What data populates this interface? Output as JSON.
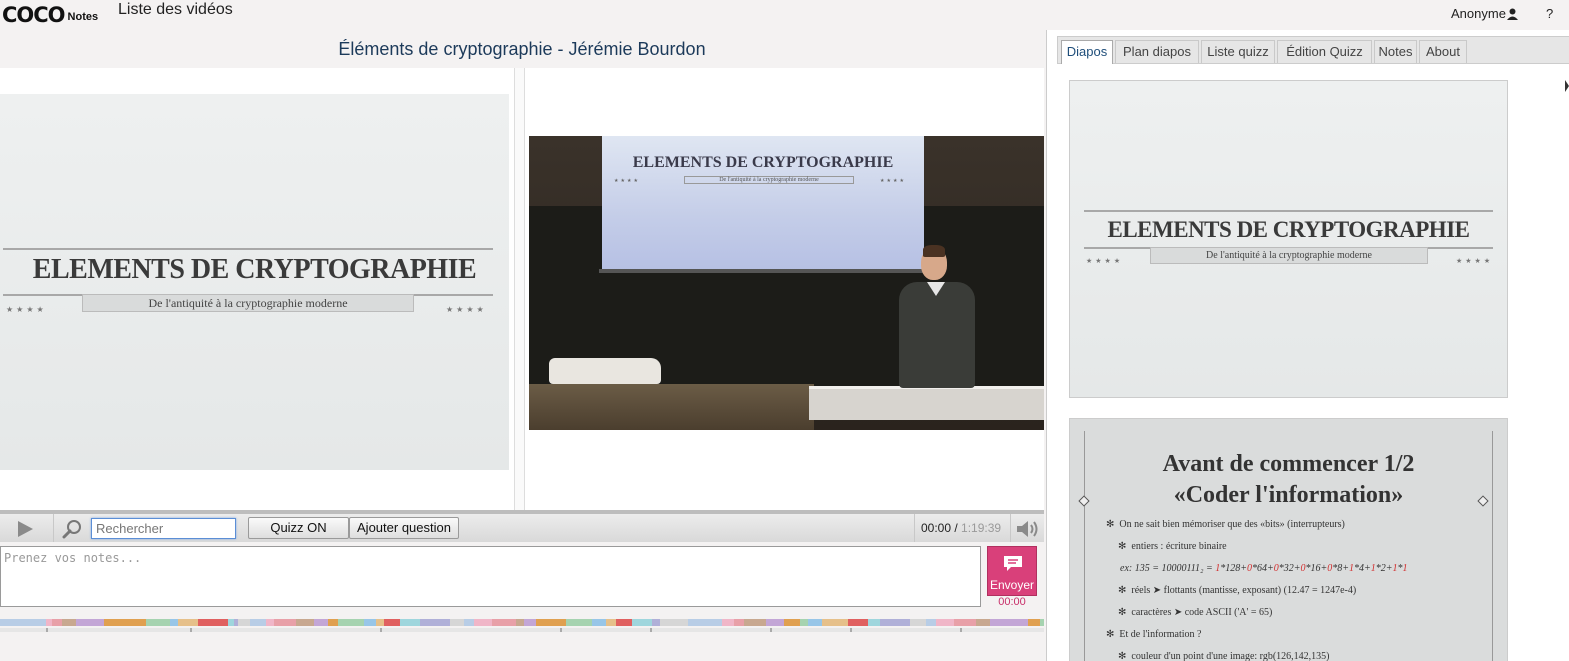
{
  "header": {
    "logo_text": "COCO",
    "logo_sub": "Notes",
    "nav_videos": "Liste des vidéos",
    "user_label": "Anonyme",
    "help_label": "?"
  },
  "video": {
    "title": "Éléments de cryptographie - Jérémie Bourdon"
  },
  "slide_main": {
    "title": "ELEMENTS DE CRYPTOGRAPHIE",
    "subtitle": "De l'antiquité à la cryptographie moderne",
    "stars_left": "★★★★",
    "stars_right": "★★★★"
  },
  "video_frame": {
    "screen_title": "ELEMENTS DE CRYPTOGRAPHIE",
    "screen_subtitle": "De l'antiquité à la cryptographie moderne",
    "screen_stars_left": "★★★★",
    "screen_stars_right": "★★★★"
  },
  "controls": {
    "search_placeholder": "Rechercher",
    "quiz_label": "Quizz ON",
    "add_question_label": "Ajouter question",
    "time_current": "00:00",
    "time_sep": " / ",
    "time_total": "1:19:39"
  },
  "notes": {
    "placeholder": "Prenez vos notes...",
    "send_label": "Envoyer",
    "send_time": "00:00"
  },
  "tabs": [
    {
      "label": "Diapos",
      "active": true
    },
    {
      "label": "Plan diapos",
      "active": false
    },
    {
      "label": "Liste quizz",
      "active": false
    },
    {
      "label": "Édition Quizz",
      "active": false
    },
    {
      "label": "Notes",
      "active": false
    },
    {
      "label": "About",
      "active": false
    }
  ],
  "thumbnails": [
    {
      "title": "ELEMENTS DE CRYPTOGRAPHIE",
      "subtitle": "De l'antiquité à la cryptographie moderne",
      "stars_left": "★★★★",
      "stars_right": "★★★★"
    },
    {
      "title_line1": "Avant de commencer 1/2",
      "title_line2": "«Coder l'information»",
      "bullets": [
        "On ne sait bien mémoriser que des «bits» (interrupteurs)",
        "entiers : écriture binaire",
        "ex: 135 = 10000111₂ = 1*128+0*64+0*32+0*16+0*8+1*4+1*2+1*1",
        "réels ➤ flottants (mantisse, exposant) (12.47 = 1247e-4)",
        "caractères ➤ code ASCII ('A' = 65)",
        "Et de l'information ?",
        "couleur d'un point d'une image: rgb(126,142,135)"
      ]
    }
  ],
  "colors": {
    "accent": "#d9407a",
    "title_blue": "#1c3a5a",
    "tab_active_text": "#1f4e7a"
  }
}
